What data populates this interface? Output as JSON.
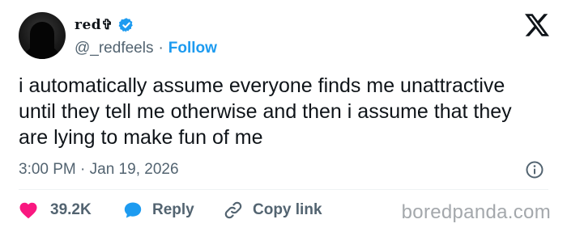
{
  "author": {
    "display_name": "red✞",
    "handle": "@_redfeels",
    "separator": "·",
    "follow_label": "Follow"
  },
  "tweet": {
    "text": "i automatically assume everyone finds me unattractive until they tell me otherwise and then i assume that they are lying to make fun of me",
    "timestamp": "3:00 PM · Jan 19, 2026"
  },
  "actions": {
    "like_count": "39.2K",
    "reply_label": "Reply",
    "copy_link_label": "Copy link"
  },
  "watermark": "boredpanda.com",
  "icons": {
    "verified": "verified-badge-icon",
    "platform_logo": "x-logo-icon",
    "info": "info-icon",
    "like": "heart-icon",
    "reply": "speech-bubble-icon",
    "copy_link": "link-icon"
  },
  "colors": {
    "accent": "#1d9bf0",
    "like": "#f91880",
    "secondary_text": "#536471",
    "primary_text": "#0f1419"
  }
}
